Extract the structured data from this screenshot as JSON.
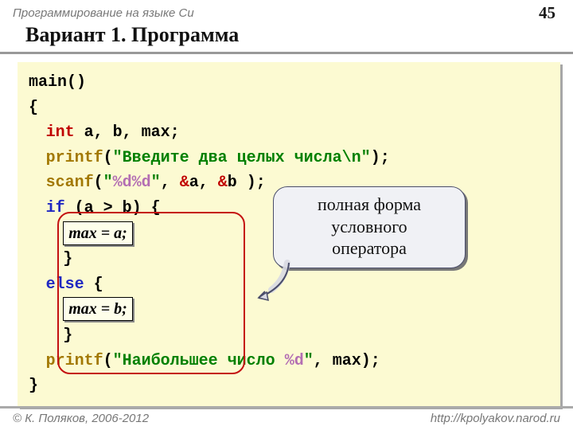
{
  "header": {
    "course": "Программирование на языке Си",
    "page": "45"
  },
  "title": "Вариант 1. Программа",
  "code": {
    "l1_main": "main()",
    "l2": "{",
    "l3_int": "int",
    "l3_rest": " a, b, max;",
    "l4_fn": "printf",
    "l4_open": "(",
    "l4_str": "\"Введите два целых числа\\n\"",
    "l4_close": ");",
    "l5_fn": "scanf",
    "l5_open": "(",
    "l5_q1": "\"",
    "l5_f1": "%d",
    "l5_f2": "%d",
    "l5_q2": "\"",
    "l5_c1": ", ",
    "l5_amp1": "&",
    "l5_a": "a, ",
    "l5_amp2": "&",
    "l5_b": "b );",
    "l6_if": "if",
    "l6_cond": " (a > b) {",
    "l7_box": "max = a;",
    "l8": "}",
    "l9_else": "else",
    "l9_brace": " {",
    "l10_box": "max = b;",
    "l11": "}",
    "l12_fn": "printf",
    "l12_open": "(",
    "l12_q1": "\"",
    "l12_str": "Наибольшее число ",
    "l12_fmt": "%d",
    "l12_q2": "\"",
    "l12_rest": ", max);",
    "l13": "}"
  },
  "callout": "полная форма\nусловного\nоператора",
  "footer": {
    "copy": "© К. Поляков, 2006-2012",
    "url": "http://kpolyakov.narod.ru"
  }
}
